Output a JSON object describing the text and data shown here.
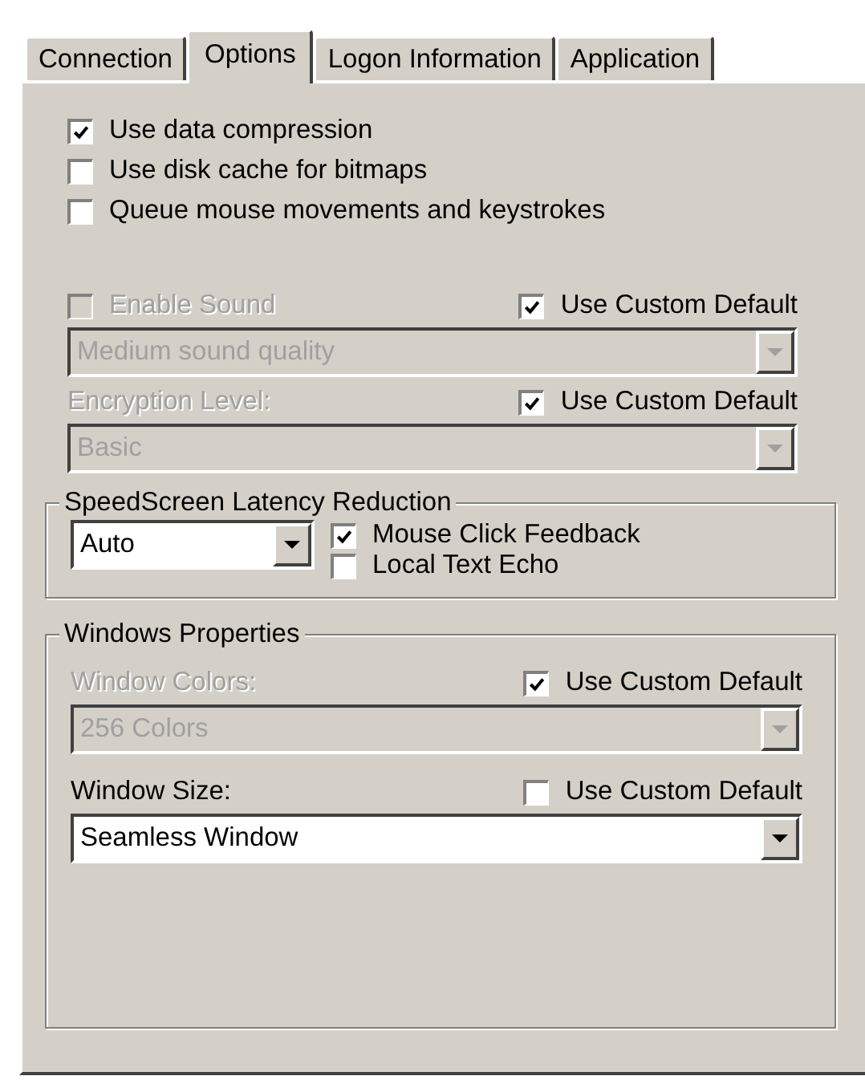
{
  "tabs": [
    {
      "label": "Connection",
      "selected": false
    },
    {
      "label": "Options",
      "selected": true
    },
    {
      "label": "Logon Information",
      "selected": false
    },
    {
      "label": "Application",
      "selected": false
    }
  ],
  "options": [
    {
      "label": "Use data compression",
      "checked": true
    },
    {
      "label": "Use disk cache for bitmaps",
      "checked": false
    },
    {
      "label": "Queue mouse movements and keystrokes",
      "checked": false
    }
  ],
  "settings": [
    {
      "kind": "checkbox",
      "label": "Enable Sound",
      "checked": false,
      "disabled": true,
      "custom_default": {
        "label": "Use Custom Default",
        "checked": true
      },
      "dropdown": {
        "value": "Medium sound quality",
        "disabled": true
      }
    },
    {
      "kind": "label",
      "label": "Encryption Level:",
      "disabled": true,
      "custom_default": {
        "label": "Use Custom Default",
        "checked": true
      },
      "dropdown": {
        "value": "Basic",
        "disabled": true
      }
    }
  ],
  "speedscreen": {
    "title": "SpeedScreen Latency Reduction",
    "dropdown": {
      "value": "Auto",
      "disabled": false
    },
    "checkboxes": [
      {
        "label": "Mouse Click Feedback",
        "checked": true
      },
      {
        "label": "Local Text Echo",
        "checked": false
      }
    ]
  },
  "windows_properties": {
    "title": "Windows Properties",
    "settings": [
      {
        "kind": "label",
        "label": "Window Colors:",
        "disabled": true,
        "custom_default": {
          "label": "Use Custom Default",
          "checked": true
        },
        "dropdown": {
          "value": "256 Colors",
          "disabled": true
        }
      },
      {
        "kind": "label",
        "label": "Window Size:",
        "disabled": false,
        "custom_default": {
          "label": "Use Custom Default",
          "checked": false
        },
        "dropdown": {
          "value": "Seamless Window",
          "disabled": false
        }
      }
    ]
  }
}
